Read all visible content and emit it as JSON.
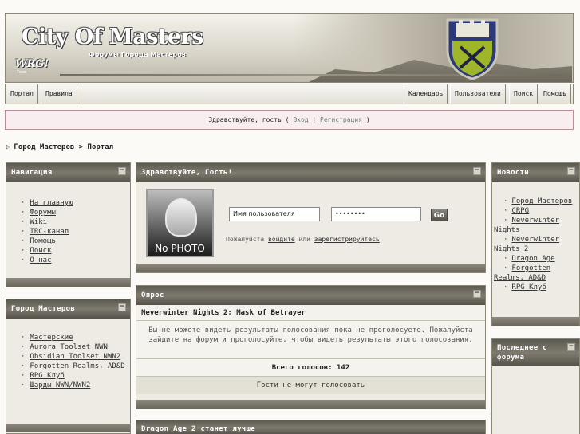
{
  "header": {
    "title": "City Of Masters",
    "subtitle": "Форумы Города Мастеров",
    "logo_text": "WRG!",
    "logo_sub": "Team"
  },
  "nav": {
    "left": [
      "Портал",
      "Правила"
    ],
    "right": [
      "Календарь",
      "Пользователи",
      "Поиск",
      "Помощь"
    ]
  },
  "welcome": {
    "greeting": "Здравствуйте, гость ( ",
    "login": "Вход",
    "sep": " | ",
    "register": "Регистрация",
    "close": " )"
  },
  "breadcrumb": {
    "arrow": "▷",
    "text": "Город Мастеров > Портал"
  },
  "panels": {
    "navigation": {
      "title": "Навигация",
      "items": [
        "На главную",
        "Форумы",
        "Wiki",
        "IRC-канал",
        "Помощь",
        "Поиск",
        "О нас"
      ]
    },
    "city": {
      "title": "Город Мастеров",
      "items": [
        "Мастерские",
        "Aurora Toolset NWN",
        "Obsidian Toolset NWN2",
        "Forgotten Realms, AD&D",
        "RPG Клуб",
        "Шарды NWN/NWN2"
      ]
    },
    "hello": {
      "title": "Здравствуйте, Гость!",
      "photo_label": "No PHOTO",
      "username_value": "Имя пользователя",
      "password_value": "••••••••",
      "go": "Go",
      "hint_pre": "Пожалуйста ",
      "hint_login": "войдите",
      "hint_mid": " или ",
      "hint_register": "зарегистрируйтесь"
    },
    "poll": {
      "title": "Опрос",
      "question": "Neverwinter Nights 2: Mask of Betrayer",
      "message": "Вы не можете видеть результаты голосования пока не проголосуете. Пожалуйста зайдите на форум и проголосуйте, чтобы видеть результаты этого голосования.",
      "total": "Всего голосов: 142",
      "guests": "Гости не могут голосовать"
    },
    "article": {
      "title": "Dragon Age 2 станет лучше"
    },
    "news": {
      "title": "Новости",
      "items": [
        "Город Мастеров",
        "CRPG",
        "Neverwinter Nights",
        "Neverwinter Nights 2",
        "Dragon Age",
        "Forgotten Realms, AD&D",
        "RPG Клуб"
      ]
    },
    "latest": {
      "title": "Последнее с форума"
    }
  },
  "minimize_symbol": "−"
}
